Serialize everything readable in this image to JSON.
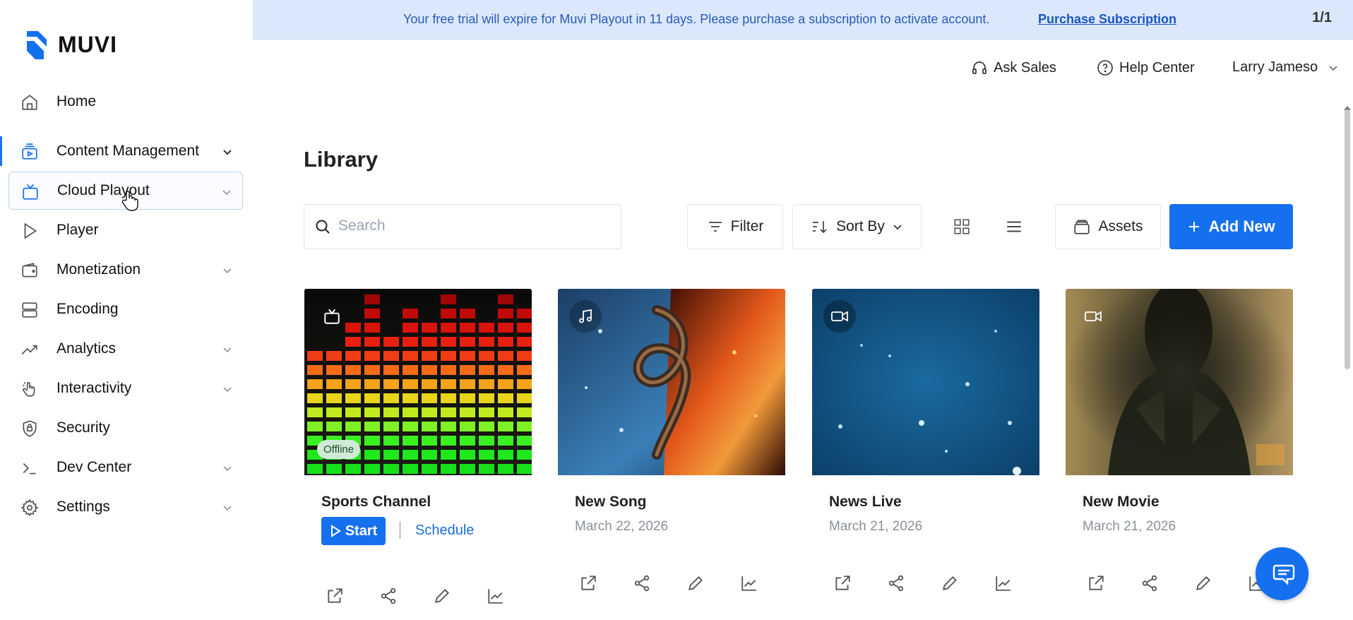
{
  "app": {
    "logo_text": "MUVI",
    "accent": "#1570ef"
  },
  "banner": {
    "message": "Your free trial will expire for Muvi Playout in 11 days. Please purchase a subscription to activate account.",
    "link": "Purchase Subscription",
    "page_indicator": "1/1"
  },
  "header": {
    "ask_sales": "Ask Sales",
    "help_center": "Help Center",
    "user_name": "Larry Jameso"
  },
  "sidebar": {
    "items": [
      {
        "label": "Home",
        "icon": "home-icon"
      },
      {
        "label": "Content Management",
        "icon": "content-icon"
      },
      {
        "label": "Cloud Playout",
        "icon": "tv-icon"
      },
      {
        "label": "Player",
        "icon": "play-icon"
      },
      {
        "label": "Monetization",
        "icon": "wallet-icon"
      },
      {
        "label": "Encoding",
        "icon": "server-icon"
      },
      {
        "label": "Analytics",
        "icon": "trend-icon"
      },
      {
        "label": "Interactivity",
        "icon": "hand-icon"
      },
      {
        "label": "Security",
        "icon": "shield-icon"
      },
      {
        "label": "Dev Center",
        "icon": "terminal-icon"
      },
      {
        "label": "Settings",
        "icon": "gear-icon"
      }
    ]
  },
  "library": {
    "title": "Library",
    "search_placeholder": "Search",
    "filter_label": "Filter",
    "sort_label": "Sort By",
    "assets_label": "Assets",
    "add_label": "Add New"
  },
  "cards": [
    {
      "title": "Sports Channel",
      "type_icon": "tv-icon",
      "badge": "Offline",
      "start_label": "Start",
      "schedule_label": "Schedule"
    },
    {
      "title": "New Song",
      "date": "March 22, 2026",
      "type_icon": "music-icon"
    },
    {
      "title": "News Live",
      "date": "March 21, 2026",
      "type_icon": "video-icon"
    },
    {
      "title": "New Movie",
      "date": "March 21, 2026",
      "type_icon": "video-icon"
    }
  ]
}
